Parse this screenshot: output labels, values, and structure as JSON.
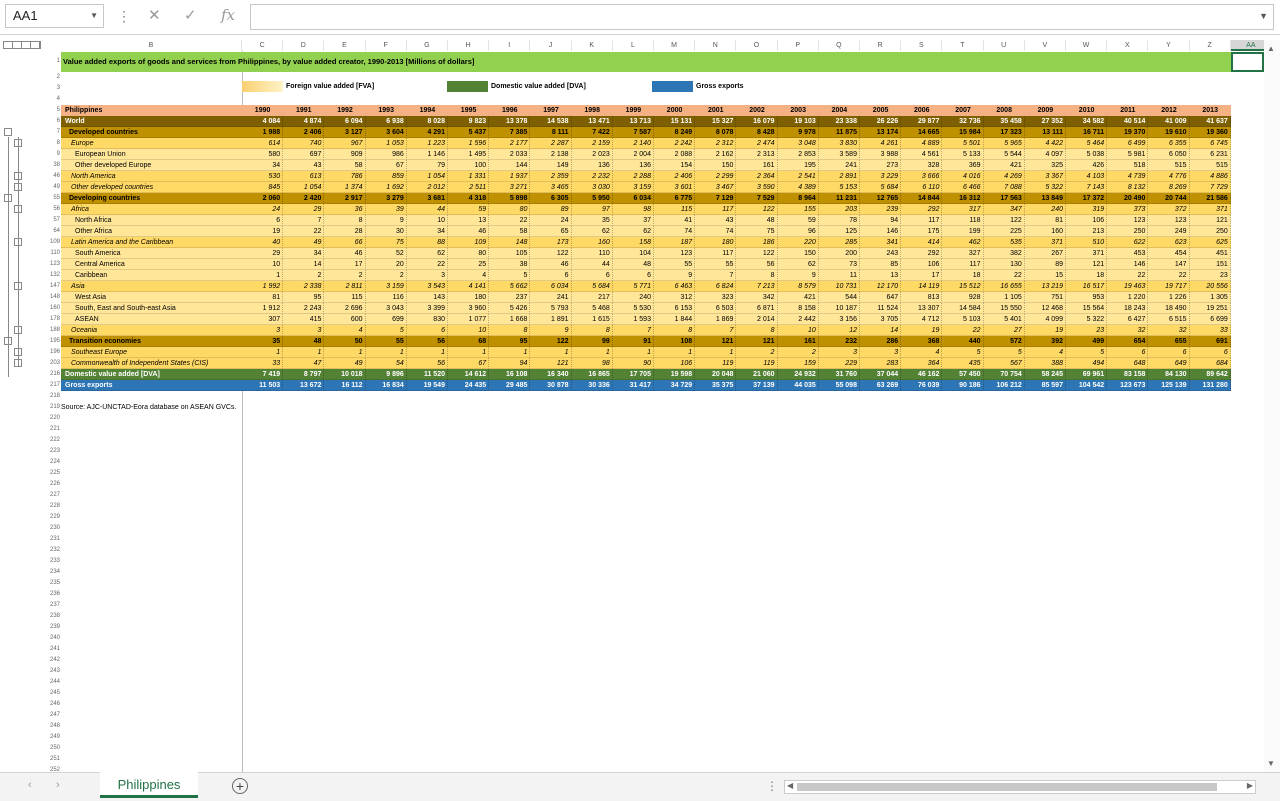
{
  "formula_bar": {
    "name_box": "AA1",
    "formula": "",
    "fx_label": "fx"
  },
  "sheet_tab": "Philippines",
  "columns": [
    "B",
    "C",
    "D",
    "E",
    "F",
    "G",
    "H",
    "I",
    "J",
    "K",
    "L",
    "M",
    "N",
    "O",
    "P",
    "Q",
    "R",
    "S",
    "T",
    "U",
    "V",
    "W",
    "X",
    "Y",
    "Z",
    "AA"
  ],
  "title": "Value added exports of goods and services from Philippines, by value added creator, 1990-2013 [Millions of dollars]",
  "legend": [
    {
      "label": "Foreign value added [FVA]",
      "color": "#f9d070"
    },
    {
      "label": "Domestic value added [DVA]",
      "color": "#548235"
    },
    {
      "label": "Gross exports",
      "color": "#2e75b6"
    }
  ],
  "source": "Source: AJC-UNCTAD-Eora database on ASEAN GVCs.",
  "header_row": {
    "num": "5",
    "label": "Philippines",
    "years": [
      "1990",
      "1991",
      "1992",
      "1993",
      "1994",
      "1995",
      "1996",
      "1997",
      "1998",
      "1999",
      "2000",
      "2001",
      "2002",
      "2003",
      "2004",
      "2005",
      "2006",
      "2007",
      "2008",
      "2009",
      "2010",
      "2011",
      "2012",
      "2013"
    ]
  },
  "rows": [
    {
      "num": "6",
      "label": "World",
      "style": "world",
      "values": [
        "4 084",
        "4 874",
        "6 094",
        "6 938",
        "8 028",
        "9 823",
        "13 378",
        "14 538",
        "13 471",
        "13 713",
        "15 131",
        "15 327",
        "16 079",
        "19 103",
        "23 338",
        "26 226",
        "29 877",
        "32 736",
        "35 458",
        "27 352",
        "34 582",
        "40 514",
        "41 009",
        "41 637"
      ]
    },
    {
      "num": "7",
      "label": "Developed countries",
      "style": "group",
      "values": [
        "1 988",
        "2 406",
        "3 127",
        "3 604",
        "4 291",
        "5 437",
        "7 385",
        "8 111",
        "7 422",
        "7 587",
        "8 249",
        "8 078",
        "8 428",
        "9 978",
        "11 875",
        "13 174",
        "14 665",
        "15 984",
        "17 323",
        "13 111",
        "16 711",
        "19 370",
        "19 610",
        "19 360"
      ]
    },
    {
      "num": "8",
      "label": "Europe",
      "style": "region",
      "values": [
        "614",
        "740",
        "967",
        "1 053",
        "1 223",
        "1 596",
        "2 177",
        "2 287",
        "2 159",
        "2 140",
        "2 242",
        "2 312",
        "2 474",
        "3 048",
        "3 830",
        "4 261",
        "4 889",
        "5 501",
        "5 965",
        "4 422",
        "5 464",
        "6 499",
        "6 355",
        "6 745"
      ]
    },
    {
      "num": "9",
      "label": "European Union",
      "style": "sub",
      "values": [
        "580",
        "697",
        "909",
        "986",
        "1 146",
        "1 495",
        "2 033",
        "2 138",
        "2 023",
        "2 004",
        "2 088",
        "2 162",
        "2 313",
        "2 853",
        "3 589",
        "3 988",
        "4 561",
        "5 133",
        "5 544",
        "4 097",
        "5 038",
        "5 981",
        "6 050",
        "6 231"
      ]
    },
    {
      "num": "38",
      "label": "Other developed Europe",
      "style": "sub",
      "values": [
        "34",
        "43",
        "58",
        "67",
        "79",
        "100",
        "144",
        "149",
        "136",
        "136",
        "154",
        "150",
        "161",
        "195",
        "241",
        "273",
        "328",
        "369",
        "421",
        "325",
        "426",
        "518",
        "515",
        "515"
      ]
    },
    {
      "num": "46",
      "label": "North America",
      "style": "region",
      "values": [
        "530",
        "613",
        "786",
        "859",
        "1 054",
        "1 331",
        "1 937",
        "2 359",
        "2 232",
        "2 288",
        "2 406",
        "2 299",
        "2 364",
        "2 541",
        "2 891",
        "3 229",
        "3 666",
        "4 016",
        "4 269",
        "3 367",
        "4 103",
        "4 739",
        "4 776",
        "4 886"
      ]
    },
    {
      "num": "49",
      "label": "Other developed countries",
      "style": "region",
      "values": [
        "845",
        "1 054",
        "1 374",
        "1 692",
        "2 012",
        "2 511",
        "3 271",
        "3 465",
        "3 030",
        "3 159",
        "3 601",
        "3 467",
        "3 590",
        "4 389",
        "5 153",
        "5 684",
        "6 110",
        "6 466",
        "7 088",
        "5 322",
        "7 143",
        "8 132",
        "8 269",
        "7 729"
      ]
    },
    {
      "num": "55",
      "label": "Developing countries",
      "style": "group",
      "values": [
        "2 060",
        "2 420",
        "2 917",
        "3 279",
        "3 681",
        "4 318",
        "5 898",
        "6 305",
        "5 950",
        "6 034",
        "6 775",
        "7 129",
        "7 529",
        "8 964",
        "11 231",
        "12 765",
        "14 844",
        "16 312",
        "17 563",
        "13 849",
        "17 372",
        "20 490",
        "20 744",
        "21 586"
      ]
    },
    {
      "num": "56",
      "label": "Africa",
      "style": "region",
      "values": [
        "24",
        "29",
        "36",
        "39",
        "44",
        "59",
        "80",
        "89",
        "97",
        "98",
        "115",
        "117",
        "122",
        "155",
        "203",
        "239",
        "292",
        "317",
        "347",
        "240",
        "319",
        "373",
        "372",
        "371"
      ]
    },
    {
      "num": "57",
      "label": "North Africa",
      "style": "sub",
      "values": [
        "6",
        "7",
        "8",
        "9",
        "10",
        "13",
        "22",
        "24",
        "35",
        "37",
        "41",
        "43",
        "48",
        "59",
        "78",
        "94",
        "117",
        "118",
        "122",
        "81",
        "106",
        "123",
        "123",
        "121"
      ]
    },
    {
      "num": "64",
      "label": "Other Africa",
      "style": "sub",
      "values": [
        "19",
        "22",
        "28",
        "30",
        "34",
        "46",
        "58",
        "65",
        "62",
        "62",
        "74",
        "74",
        "75",
        "96",
        "125",
        "146",
        "175",
        "199",
        "225",
        "160",
        "213",
        "250",
        "249",
        "250"
      ]
    },
    {
      "num": "109",
      "label": "Latin America and the Caribbean",
      "style": "region",
      "values": [
        "40",
        "49",
        "66",
        "75",
        "88",
        "109",
        "148",
        "173",
        "160",
        "158",
        "187",
        "180",
        "186",
        "220",
        "285",
        "341",
        "414",
        "462",
        "535",
        "371",
        "510",
        "622",
        "623",
        "625"
      ]
    },
    {
      "num": "110",
      "label": "South America",
      "style": "sub",
      "values": [
        "29",
        "34",
        "46",
        "52",
        "62",
        "80",
        "105",
        "122",
        "110",
        "104",
        "123",
        "117",
        "122",
        "150",
        "200",
        "243",
        "292",
        "327",
        "382",
        "267",
        "371",
        "453",
        "454",
        "451"
      ]
    },
    {
      "num": "123",
      "label": "Central America",
      "style": "sub",
      "values": [
        "10",
        "14",
        "17",
        "20",
        "22",
        "25",
        "38",
        "46",
        "44",
        "48",
        "55",
        "55",
        "56",
        "62",
        "73",
        "85",
        "106",
        "117",
        "130",
        "89",
        "121",
        "146",
        "147",
        "151"
      ]
    },
    {
      "num": "132",
      "label": "Caribbean",
      "style": "sub",
      "values": [
        "1",
        "2",
        "2",
        "2",
        "3",
        "4",
        "5",
        "6",
        "6",
        "6",
        "9",
        "7",
        "8",
        "9",
        "11",
        "13",
        "17",
        "18",
        "22",
        "15",
        "18",
        "22",
        "22",
        "23"
      ]
    },
    {
      "num": "147",
      "label": "Asia",
      "style": "region",
      "values": [
        "1 992",
        "2 338",
        "2 811",
        "3 159",
        "3 543",
        "4 141",
        "5 662",
        "6 034",
        "5 684",
        "5 771",
        "6 463",
        "6 824",
        "7 213",
        "8 579",
        "10 731",
        "12 170",
        "14 119",
        "15 512",
        "16 655",
        "13 219",
        "16 517",
        "19 463",
        "19 717",
        "20 556"
      ]
    },
    {
      "num": "148",
      "label": "West Asia",
      "style": "sub",
      "values": [
        "81",
        "95",
        "115",
        "116",
        "143",
        "180",
        "237",
        "241",
        "217",
        "240",
        "312",
        "323",
        "342",
        "421",
        "544",
        "647",
        "813",
        "928",
        "1 105",
        "751",
        "953",
        "1 220",
        "1 226",
        "1 305"
      ]
    },
    {
      "num": "160",
      "label": "South, East and South-east Asia",
      "style": "sub",
      "values": [
        "1 912",
        "2 243",
        "2 696",
        "3 043",
        "3 399",
        "3 960",
        "5 426",
        "5 793",
        "5 468",
        "5 530",
        "6 153",
        "6 503",
        "6 871",
        "8 158",
        "10 187",
        "11 524",
        "13 307",
        "14 584",
        "15 550",
        "12 468",
        "15 564",
        "18 243",
        "18 490",
        "19 251"
      ]
    },
    {
      "num": "178",
      "label": "ASEAN",
      "style": "sub",
      "values": [
        "307",
        "415",
        "600",
        "699",
        "830",
        "1 077",
        "1 668",
        "1 891",
        "1 615",
        "1 593",
        "1 844",
        "1 869",
        "2 014",
        "2 442",
        "3 156",
        "3 705",
        "4 712",
        "5 103",
        "5 401",
        "4 099",
        "5 322",
        "6 427",
        "6 515",
        "6 699"
      ]
    },
    {
      "num": "188",
      "label": "Oceania",
      "style": "region",
      "values": [
        "3",
        "3",
        "4",
        "5",
        "6",
        "10",
        "8",
        "9",
        "8",
        "7",
        "8",
        "7",
        "8",
        "10",
        "12",
        "14",
        "19",
        "22",
        "27",
        "19",
        "23",
        "32",
        "32",
        "33"
      ]
    },
    {
      "num": "195",
      "label": "Transition economies",
      "style": "group",
      "values": [
        "35",
        "48",
        "50",
        "55",
        "56",
        "68",
        "95",
        "122",
        "99",
        "91",
        "108",
        "121",
        "121",
        "161",
        "232",
        "286",
        "368",
        "440",
        "572",
        "392",
        "499",
        "654",
        "655",
        "691"
      ]
    },
    {
      "num": "196",
      "label": "Southeast Europe",
      "style": "region",
      "values": [
        "1",
        "1",
        "1",
        "1",
        "1",
        "1",
        "1",
        "1",
        "1",
        "1",
        "1",
        "1",
        "2",
        "2",
        "3",
        "3",
        "4",
        "5",
        "5",
        "4",
        "5",
        "6",
        "6",
        "6"
      ]
    },
    {
      "num": "203",
      "label": "Commonwealth of Independent States (CIS)",
      "style": "region",
      "values": [
        "33",
        "47",
        "49",
        "54",
        "56",
        "67",
        "94",
        "121",
        "98",
        "90",
        "106",
        "119",
        "119",
        "159",
        "229",
        "283",
        "364",
        "435",
        "567",
        "388",
        "494",
        "648",
        "649",
        "684"
      ]
    },
    {
      "num": "216",
      "label": "Domestic value added [DVA]",
      "style": "dva",
      "values": [
        "7 419",
        "8 797",
        "10 018",
        "9 896",
        "11 520",
        "14 612",
        "16 108",
        "16 340",
        "16 865",
        "17 705",
        "19 598",
        "20 048",
        "21 060",
        "24 932",
        "31 760",
        "37 044",
        "46 162",
        "57 450",
        "70 754",
        "58 245",
        "69 961",
        "83 158",
        "84 130",
        "89 642"
      ]
    },
    {
      "num": "217",
      "label": "Gross exports",
      "style": "gross",
      "values": [
        "11 503",
        "13 672",
        "16 112",
        "16 834",
        "19 549",
        "24 435",
        "29 485",
        "30 878",
        "30 336",
        "31 417",
        "34 729",
        "35 375",
        "37 139",
        "44 035",
        "55 098",
        "63 269",
        "76 039",
        "90 186",
        "106 212",
        "85 597",
        "104 542",
        "123 673",
        "125 139",
        "131 280"
      ]
    }
  ],
  "row_numbers_before": [
    "1",
    "2",
    "3",
    "4"
  ],
  "row_numbers_after": [
    "218",
    "219",
    "220",
    "221",
    "222",
    "223",
    "224",
    "225",
    "226",
    "227",
    "228",
    "229",
    "230",
    "231",
    "232",
    "233",
    "234",
    "235",
    "236",
    "237",
    "238",
    "239",
    "240",
    "241",
    "242",
    "243",
    "244",
    "245",
    "246",
    "247",
    "248",
    "249",
    "250",
    "251",
    "252"
  ],
  "colors": {
    "title_bg": "#92d050",
    "header_bg": "#f4b183",
    "world_bg": "#7f6000",
    "group_bg": "#bf9000",
    "region_bg": "#ffd966",
    "sub_bg": "#ffe699",
    "dva_bg": "#548235",
    "gross_bg": "#2e75b6",
    "accent": "#217346"
  }
}
